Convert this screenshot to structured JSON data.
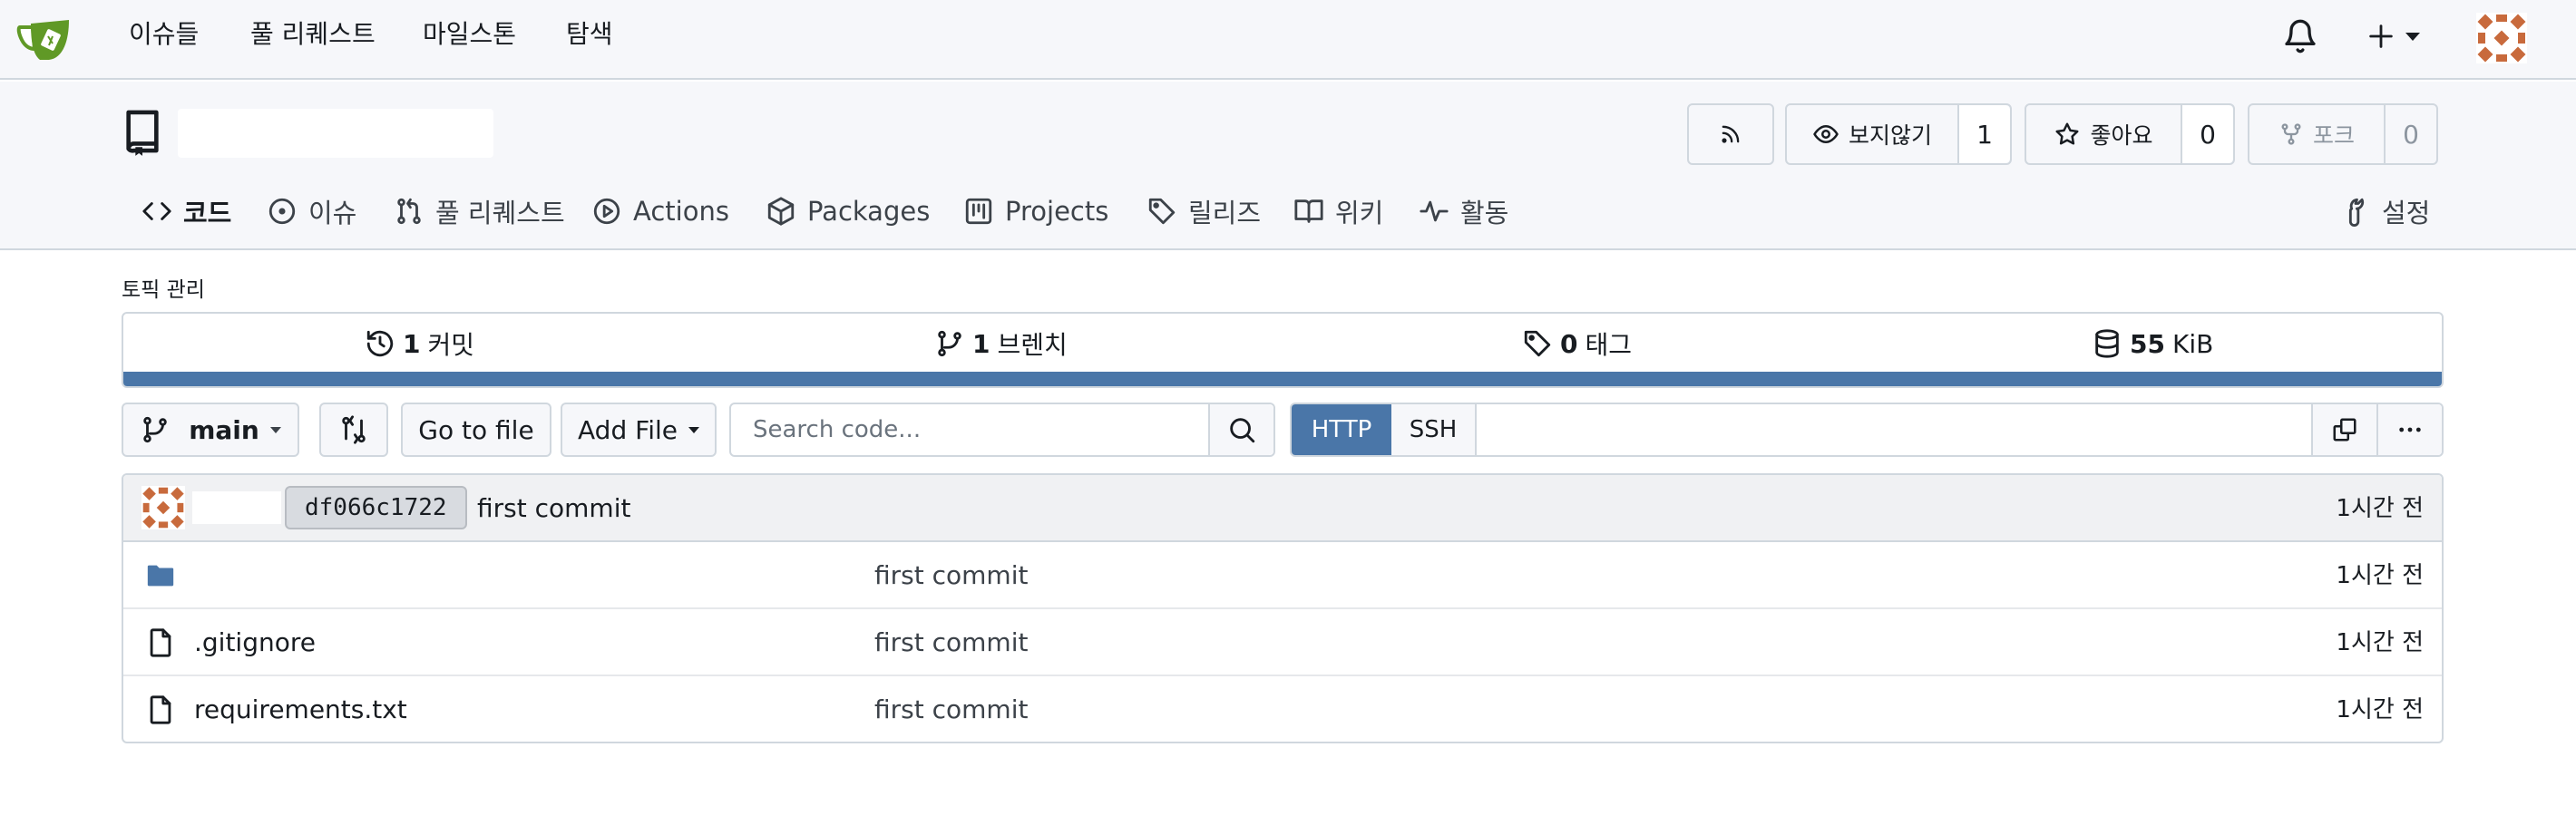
{
  "nav": {
    "links": [
      "이슈들",
      "풀 리퀘스트",
      "마일스톤",
      "탐색"
    ]
  },
  "repo": {
    "actions": {
      "watch_label": "보지않기",
      "watch_count": "1",
      "star_label": "좋아요",
      "star_count": "0",
      "fork_label": "포크",
      "fork_count": "0"
    },
    "tabs": [
      "코드",
      "이슈",
      "풀 리퀘스트",
      "Actions",
      "Packages",
      "Projects",
      "릴리즈",
      "위키",
      "활동"
    ],
    "settings_label": "설정"
  },
  "topics": {
    "label": "토픽 관리"
  },
  "stats": {
    "commits_num": "1",
    "commits_label": "커밋",
    "branches_num": "1",
    "branches_label": "브렌치",
    "tags_num": "0",
    "tags_label": "태그",
    "size_num": "55",
    "size_label": "KiB"
  },
  "toolbar": {
    "branch": "main",
    "go_to_file": "Go to file",
    "add_file": "Add File",
    "search_placeholder": "Search code...",
    "http_label": "HTTP",
    "ssh_label": "SSH"
  },
  "latest_commit": {
    "sha": "df066c1722",
    "message": "first commit",
    "time": "1시간 전"
  },
  "files": [
    {
      "type": "folder",
      "name": "",
      "message": "first commit",
      "time": "1시간 전"
    },
    {
      "type": "file",
      "name": ".gitignore",
      "message": "first commit",
      "time": "1시간 전"
    },
    {
      "type": "file",
      "name": "requirements.txt",
      "message": "first commit",
      "time": "1시간 전"
    }
  ],
  "colors": {
    "accent": "#4a76a8",
    "logo": "#609926",
    "avatar": "#c86a3c"
  }
}
